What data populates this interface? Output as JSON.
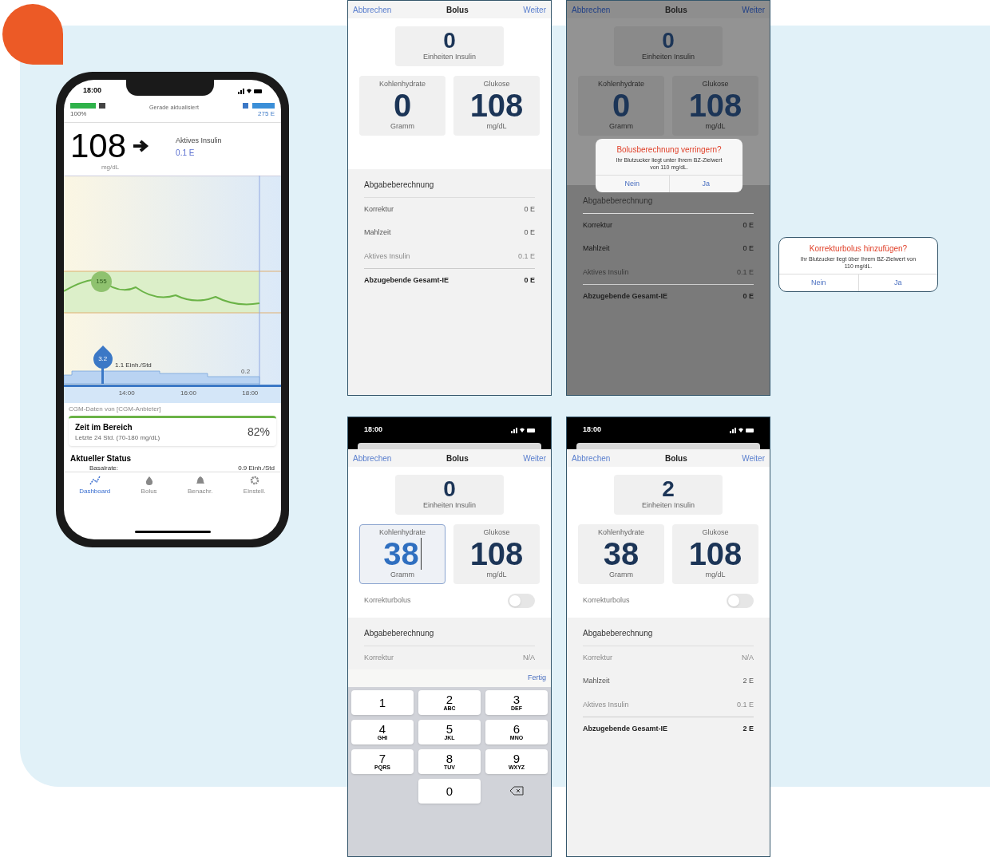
{
  "phone": {
    "status_time": "18:00",
    "battery_label": "100%",
    "update_status": "Gerade aktualisiert",
    "reservoir_label": "275 E",
    "glucose": "108",
    "glucose_unit": "mg/dL",
    "active_insulin_label": "Aktives Insulin",
    "active_insulin_value": "0.1 E",
    "chart": {
      "reading_bubble": "155",
      "bolus_bubble": "3.2",
      "basal_label": "1.1 Einh./Std",
      "basal_end_label": "0.2",
      "times": [
        "14:00",
        "16:00",
        "18:00"
      ]
    },
    "cgm_note": "CGM-Daten von [CGM-Anbieter]",
    "time_in_range": {
      "title": "Zeit im Bereich",
      "subtitle": "Letzte 24 Std. (70-180 mg/dL)",
      "value": "82%"
    },
    "status_title": "Aktueller Status",
    "status_row": {
      "label": "Basalrate:",
      "value": "0.9 Einh./Std"
    },
    "tabs": [
      {
        "label": "Dashboard",
        "selected": true
      },
      {
        "label": "Bolus",
        "selected": false
      },
      {
        "label": "Benachr.",
        "selected": false
      },
      {
        "label": "Einstell.",
        "selected": false
      }
    ]
  },
  "screens": [
    {
      "cancel": "Abbrechen",
      "title": "Bolus",
      "next": "Weiter",
      "total": {
        "value": "0",
        "label": "Einheiten Insulin"
      },
      "carbs": {
        "label": "Kohlenhydrate",
        "value": "0",
        "unit": "Gramm",
        "editing": false
      },
      "glucose": {
        "label": "Glukose",
        "value": "108",
        "unit": "mg/dL"
      },
      "calc_title": "Abgabeberechnung",
      "rows": [
        {
          "label": "Korrektur",
          "value": "0 E",
          "disabled": false
        },
        {
          "label": "Mahlzeit",
          "value": "0 E",
          "disabled": false
        },
        {
          "label": "Aktives Insulin",
          "value": "0.1 E",
          "disabled": true
        }
      ],
      "total_row": {
        "label": "Abzugebende Gesamt-IE",
        "value": "0 E"
      },
      "dimmed": false
    },
    {
      "cancel": "Abbrechen",
      "title": "Bolus",
      "next": "Weiter",
      "total": {
        "value": "0",
        "label": "Einheiten Insulin"
      },
      "carbs": {
        "label": "Kohlenhydrate",
        "value": "0",
        "unit": "Gramm",
        "editing": false
      },
      "glucose": {
        "label": "Glukose",
        "value": "108",
        "unit": "mg/dL"
      },
      "calc_title": "Abgabeberechnung",
      "rows": [
        {
          "label": "Korrektur",
          "value": "0 E",
          "disabled": false
        },
        {
          "label": "Mahlzeit",
          "value": "0 E",
          "disabled": false
        },
        {
          "label": "Aktives Insulin",
          "value": "0.1 E",
          "disabled": true
        }
      ],
      "total_row": {
        "label": "Abzugebende Gesamt-IE",
        "value": "0 E"
      },
      "dimmed": true,
      "dialog": {
        "title": "Bolusberechnung verringern?",
        "message": "Ihr Blutzucker liegt unter Ihrem BZ-Zielwert von 110 mg/dL.",
        "no": "Nein",
        "yes": "Ja"
      }
    },
    {
      "status_time": "18:00",
      "cancel": "Abbrechen",
      "title": "Bolus",
      "next": "Weiter",
      "total": {
        "value": "0",
        "label": "Einheiten Insulin"
      },
      "carbs": {
        "label": "Kohlenhydrate",
        "value": "38",
        "unit": "Gramm",
        "editing": true
      },
      "glucose": {
        "label": "Glukose",
        "value": "108",
        "unit": "mg/dL"
      },
      "correction": {
        "label": "Korrekturbolus",
        "on": false
      },
      "calc_title": "Abgabeberechnung",
      "rows": [
        {
          "label": "Korrektur",
          "value": "N/A",
          "disabled": true
        }
      ],
      "dimmed": false,
      "keyboard": {
        "done": "Fertig",
        "keys": [
          {
            "digit": "1"
          },
          {
            "digit": "2",
            "letters": "ABC"
          },
          {
            "digit": "3",
            "letters": "DEF"
          },
          {
            "digit": "4",
            "letters": "GHI"
          },
          {
            "digit": "5",
            "letters": "JKL"
          },
          {
            "digit": "6",
            "letters": "MNO"
          },
          {
            "digit": "7",
            "letters": "PQRS"
          },
          {
            "digit": "8",
            "letters": "TUV"
          },
          {
            "digit": "9",
            "letters": "WXYZ"
          },
          {
            "digit": "0"
          }
        ]
      }
    },
    {
      "status_time": "18:00",
      "cancel": "Abbrechen",
      "title": "Bolus",
      "next": "Weiter",
      "total": {
        "value": "2",
        "label": "Einheiten Insulin"
      },
      "carbs": {
        "label": "Kohlenhydrate",
        "value": "38",
        "unit": "Gramm",
        "editing": false
      },
      "glucose": {
        "label": "Glukose",
        "value": "108",
        "unit": "mg/dL"
      },
      "correction": {
        "label": "Korrekturbolus",
        "on": false
      },
      "calc_title": "Abgabeberechnung",
      "rows": [
        {
          "label": "Korrektur",
          "value": "N/A",
          "disabled": true
        },
        {
          "label": "Mahlzeit",
          "value": "2 E",
          "disabled": false
        },
        {
          "label": "Aktives Insulin",
          "value": "0.1 E",
          "disabled": true
        }
      ],
      "total_row": {
        "label": "Abzugebende Gesamt-IE",
        "value": "2 E"
      },
      "dimmed": false
    }
  ],
  "callout_dialog": {
    "title": "Korrekturbolus hinzufügen?",
    "message": "Ihr Blutzucker liegt über Ihrem BZ-Zielwert von 110 mg/dL.",
    "no": "Nein",
    "yes": "Ja"
  }
}
